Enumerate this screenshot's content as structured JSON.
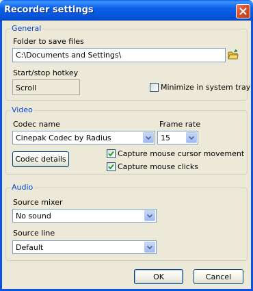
{
  "window": {
    "title": "Recorder settings"
  },
  "general": {
    "legend": "General",
    "folder_label": "Folder to save files",
    "folder_value": "C:\\Documents and Settings\\",
    "hotkey_label": "Start/stop hotkey",
    "hotkey_value": "Scroll",
    "minimize_label": "Minimize in system tray",
    "minimize_checked": false
  },
  "video": {
    "legend": "Video",
    "codec_label": "Codec name",
    "codec_value": "Cinepak Codec by Radius",
    "framerate_label": "Frame rate",
    "framerate_value": "15",
    "codec_details_button": "Codec details",
    "capture_cursor_label": "Capture mouse cursor movement",
    "capture_cursor_checked": true,
    "capture_clicks_label": "Capture mouse clicks",
    "capture_clicks_checked": true
  },
  "audio": {
    "legend": "Audio",
    "source_mixer_label": "Source mixer",
    "source_mixer_value": "No sound",
    "source_line_label": "Source line",
    "source_line_value": "Default"
  },
  "buttons": {
    "ok": "OK",
    "cancel": "Cancel"
  },
  "colors": {
    "titlebar": "#0a5ee8",
    "group_legend": "#0046d5",
    "check_mark": "#21a121",
    "close_button": "#d4502f"
  }
}
